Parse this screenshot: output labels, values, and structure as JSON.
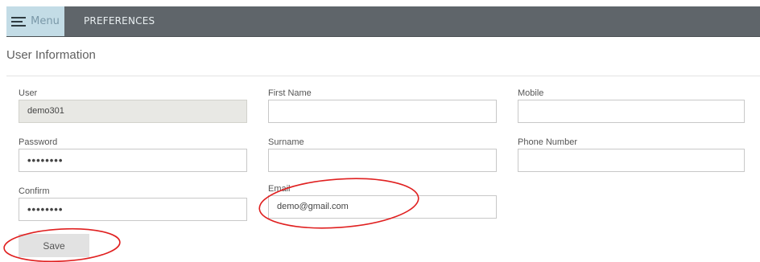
{
  "topbar": {
    "menu_label": "Menu",
    "preferences_label": "PREFERENCES"
  },
  "section": {
    "title": "User Information"
  },
  "form": {
    "user": {
      "label": "User",
      "value": "demo301"
    },
    "password": {
      "label": "Password",
      "value": "••••••••"
    },
    "confirm": {
      "label": "Confirm",
      "value": "••••••••"
    },
    "first_name": {
      "label": "First Name",
      "value": ""
    },
    "surname": {
      "label": "Surname",
      "value": ""
    },
    "email": {
      "label": "Email",
      "value": "demo@gmail.com"
    },
    "mobile": {
      "label": "Mobile",
      "value": ""
    },
    "phone_number": {
      "label": "Phone Number",
      "value": ""
    }
  },
  "actions": {
    "save_label": "Save"
  },
  "colors": {
    "topbar": "#5f656a",
    "menu_button": "#c3dce6",
    "annotation": "#e02020"
  },
  "icons": {
    "menu": "hamburger-menu-icon"
  }
}
